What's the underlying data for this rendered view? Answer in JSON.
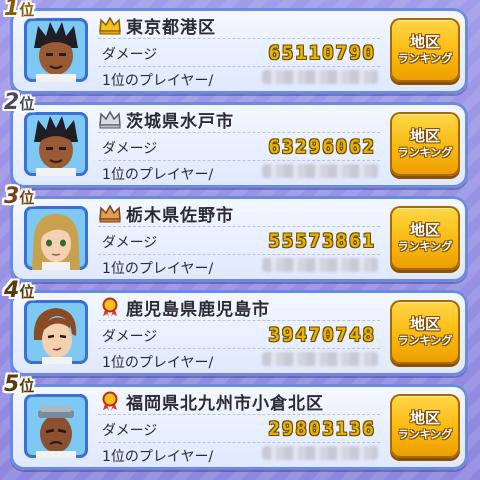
{
  "colors": {
    "background": "#9a93e6",
    "damage": "#e8b400",
    "button": "#f9b90f",
    "frame": "#6a8be0"
  },
  "rankings": [
    {
      "rank": "1",
      "suffix": "位",
      "badge_icon": "gold-crown-icon",
      "region": "東京都港区",
      "damage_label": "ダメージ",
      "damage": "65110790",
      "player_label": "1位のプレイヤー/",
      "button_line1": "地区",
      "button_line2": "ランキング"
    },
    {
      "rank": "2",
      "suffix": "位",
      "badge_icon": "silver-crown-icon",
      "region": "茨城県水戸市",
      "damage_label": "ダメージ",
      "damage": "63296062",
      "player_label": "1位のプレイヤー/",
      "button_line1": "地区",
      "button_line2": "ランキング"
    },
    {
      "rank": "3",
      "suffix": "位",
      "badge_icon": "bronze-crown-icon",
      "region": "栃木県佐野市",
      "damage_label": "ダメージ",
      "damage": "55573861",
      "player_label": "1位のプレイヤー/",
      "button_line1": "地区",
      "button_line2": "ランキング"
    },
    {
      "rank": "4",
      "suffix": "位",
      "badge_icon": "red-medal-icon",
      "region": "鹿児島県鹿児島市",
      "damage_label": "ダメージ",
      "damage": "39470748",
      "player_label": "1位のプレイヤー/",
      "button_line1": "地区",
      "button_line2": "ランキング"
    },
    {
      "rank": "5",
      "suffix": "位",
      "badge_icon": "red-medal-icon",
      "region": "福岡県北九州市小倉北区",
      "damage_label": "ダメージ",
      "damage": "29803136",
      "player_label": "1位のプレイヤー/",
      "button_line1": "地区",
      "button_line2": "ランキング"
    }
  ]
}
